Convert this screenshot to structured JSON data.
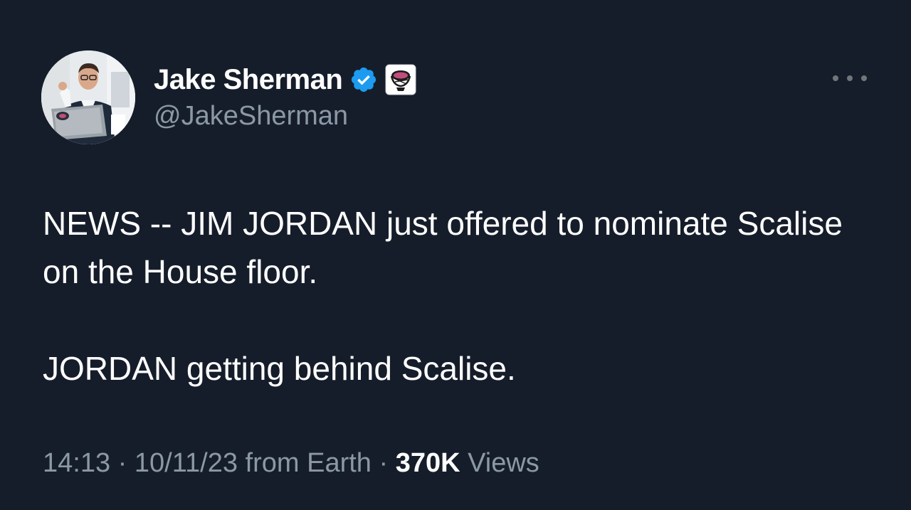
{
  "author": {
    "display_name": "Jake Sherman",
    "handle": "@JakeSherman",
    "verified": true,
    "verified_color": "#1d9bf0",
    "avatar_icon": "profile-photo",
    "affiliate_badge_icon": "punchbowl-news-logo"
  },
  "menu": {
    "icon": "more-horizontal-icon"
  },
  "tweet": {
    "paragraphs": [
      "NEWS -- JIM JORDAN just offered to nominate Scalise on the House floor.",
      "JORDAN getting behind Scalise."
    ]
  },
  "meta": {
    "time": "14:13",
    "separator": " · ",
    "date": "10/11/23",
    "source": "from Earth",
    "views_count": "370K",
    "views_label": "Views"
  },
  "colors": {
    "background": "#161d2a",
    "text_primary": "#ffffff",
    "text_secondary": "#8b98a5"
  }
}
